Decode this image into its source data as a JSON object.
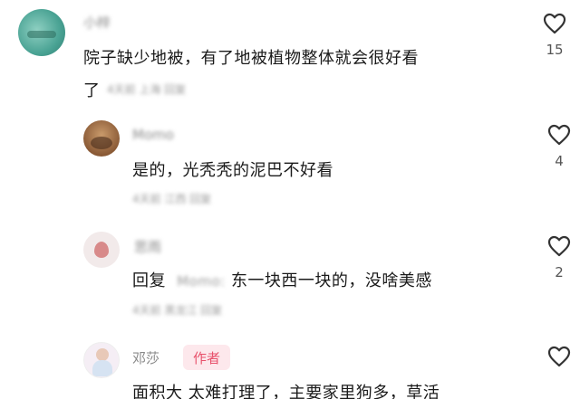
{
  "comments": [
    {
      "user": "小梓",
      "text_line1": "院子缺少地被，有了地被植物整体就会很好看",
      "text_line2": "了",
      "meta": "4天前 上海 回复",
      "likes": "15"
    },
    {
      "user": "Momo",
      "text": "是的，光秃秃的泥巴不好看",
      "meta": "4天前 江西 回复",
      "likes": "4"
    },
    {
      "user": "思雨",
      "reply_prefix": "回复",
      "reply_to": "Momo:",
      "text": "东一块西一块的，没啥美感",
      "meta": "4天前 黑龙江 回复",
      "likes": "2"
    },
    {
      "user": "邓莎",
      "badge": "作者",
      "text": "面积大 太难打理了，主要家里狗多，草活"
    }
  ],
  "icons": {
    "like": "heart-outline-icon"
  }
}
